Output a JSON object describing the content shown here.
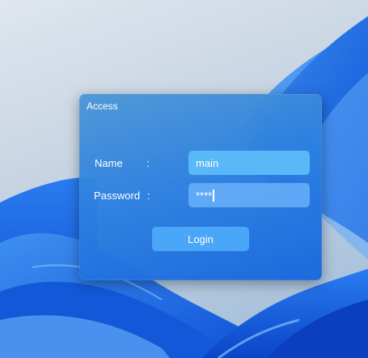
{
  "dialog": {
    "title": "Access",
    "name_label": "Name",
    "password_label": "Password",
    "colon": ":",
    "name_value": "main",
    "password_value": "****",
    "login_label": "Login"
  },
  "colors": {
    "dialog_blue": "#2d80e0",
    "name_input": "#58b8f8",
    "password_input": "#68b0fa",
    "button": "#4aa6f7",
    "wallpaper_blue": "#1a6ae8"
  }
}
